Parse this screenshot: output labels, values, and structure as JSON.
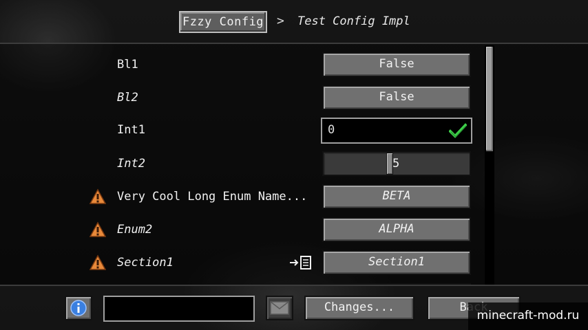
{
  "header": {
    "root_label": "Fzzy Config",
    "separator": ">",
    "current_label": "Test Config Impl"
  },
  "rows": [
    {
      "label": "Bl1",
      "control": "False",
      "italic": false
    },
    {
      "label": "Bl2",
      "control": "False",
      "italic": true
    },
    {
      "label": "Int1",
      "value": "0",
      "italic": false
    },
    {
      "label": "Int2",
      "value": "5",
      "italic": true,
      "slider_fraction": 0.45
    },
    {
      "label": "Very Cool Long Enum Name...",
      "control": "BETA",
      "italic": false,
      "warning": true
    },
    {
      "label": "Enum2",
      "control": "ALPHA",
      "italic": true,
      "warning": true
    },
    {
      "label": "Section1",
      "control": "Section1",
      "italic": true,
      "warning": true
    }
  ],
  "footer": {
    "changes_label": "Changes...",
    "back_label": "Back",
    "search_value": ""
  },
  "watermark": "minecraft-mod.ru",
  "colors": {
    "warning": "#e8893a",
    "check": "#3ecf4a",
    "info": "#3a7fe0"
  },
  "icons": [
    "warning-icon",
    "goto-section-icon",
    "check-icon",
    "info-icon",
    "mail-icon"
  ]
}
